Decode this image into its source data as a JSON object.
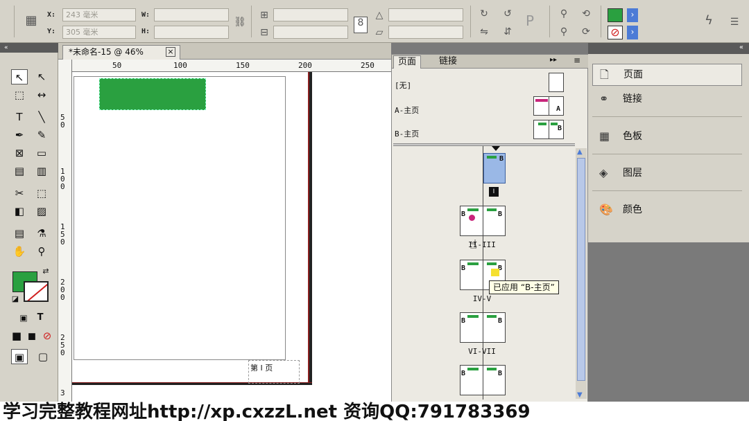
{
  "control": {
    "x_label": "X:",
    "y_label": "Y:",
    "w_label": "W:",
    "h_label": "H:",
    "x_value": "243 毫米",
    "y_value": "305 毫米",
    "fill_color": "#2aa040",
    "stroke_none_color": "#d02020"
  },
  "document": {
    "tab_title": "*未命名-15 @ 46%",
    "tab_close": "×",
    "page_label": "第 I 页",
    "green_box_color": "#2aa040"
  },
  "ruler": {
    "top": [
      "50",
      "100",
      "150",
      "200",
      "250"
    ],
    "left": [
      "5\n0",
      "1\n0\n0",
      "1\n5\n0",
      "2\n0\n0",
      "2\n5\n0",
      "3"
    ]
  },
  "pages_panel": {
    "tab_pages": "页面",
    "tab_links": "链接",
    "masters": [
      {
        "name": "[无]"
      },
      {
        "name": "A-主页"
      },
      {
        "name": "B-主页"
      }
    ],
    "first_page_label": "I",
    "spreads": [
      {
        "label": "II-III"
      },
      {
        "label": "IV-V"
      },
      {
        "label": "VI-VII"
      },
      {
        "label": ""
      }
    ],
    "tooltip": "已应用 “B-主页”",
    "master_letter_a": "A",
    "master_letter_b": "B"
  },
  "dock": {
    "items": [
      {
        "label": "页面",
        "icon": "pages-icon"
      },
      {
        "label": "链接",
        "icon": "links-icon"
      },
      {
        "label": "色板",
        "icon": "swatches-icon"
      },
      {
        "label": "图层",
        "icon": "layers-icon"
      },
      {
        "label": "颜色",
        "icon": "color-icon"
      }
    ]
  },
  "watermark": "学习完整教程网址http://xp.cxzzL.net 资询QQ:791783369"
}
